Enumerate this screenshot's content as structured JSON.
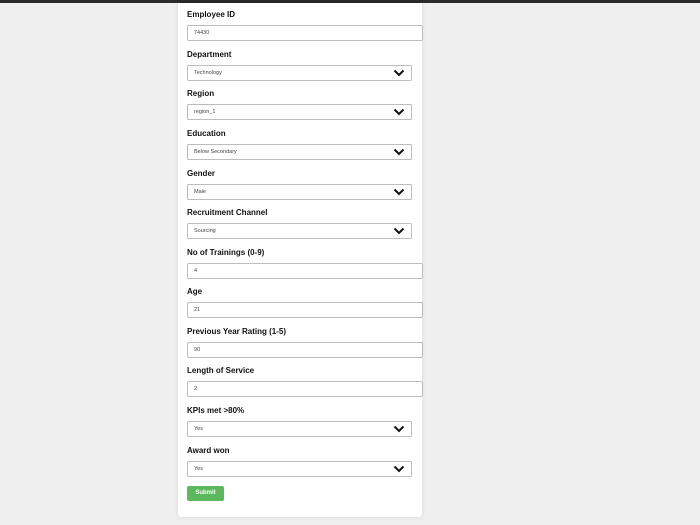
{
  "form": {
    "fields": [
      {
        "label": "Employee ID",
        "value": "74430",
        "type": "text"
      },
      {
        "label": "Department",
        "value": "Technology",
        "type": "select"
      },
      {
        "label": "Region",
        "value": "region_1",
        "type": "select"
      },
      {
        "label": "Education",
        "value": "Below Secondary",
        "type": "select"
      },
      {
        "label": "Gender",
        "value": "Male",
        "type": "select"
      },
      {
        "label": "Recruitment Channel",
        "value": "Sourcing",
        "type": "select"
      },
      {
        "label": "No of Trainings (0-9)",
        "value": "4",
        "type": "text"
      },
      {
        "label": "Age",
        "value": "21",
        "type": "text"
      },
      {
        "label": "Previous Year Rating (1-5)",
        "value": "90",
        "type": "text"
      },
      {
        "label": "Length of Service",
        "value": "2",
        "type": "text"
      },
      {
        "label": "KPIs met >80%",
        "value": "Yes",
        "type": "select"
      },
      {
        "label": "Award won",
        "value": "Yes",
        "type": "select"
      }
    ],
    "submit_label": "Submit"
  },
  "colors": {
    "submit_bg": "#5cb85c",
    "background": "#efefef",
    "card": "#ffffff"
  },
  "icons": {
    "select_chevron": "chevron-down-icon"
  }
}
